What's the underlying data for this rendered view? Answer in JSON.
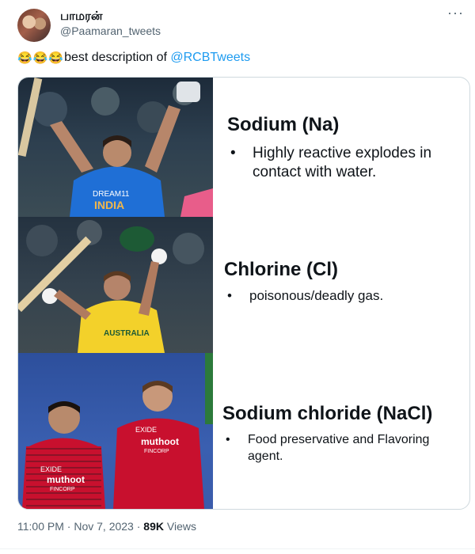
{
  "author": {
    "name": "பாமரன்",
    "handle": "@Paamaran_tweets"
  },
  "menu_icon": "more-horizontal-icon",
  "tweet": {
    "emojis": [
      "😂",
      "😂",
      "😂"
    ],
    "text": "best description of ",
    "mention": "@RCBTweets"
  },
  "card": {
    "sections": [
      {
        "title": "Sodium (Na)",
        "bullet": "Highly reactive explodes in contact with water."
      },
      {
        "title": "Chlorine (Cl)",
        "bullet": "poisonous/deadly gas."
      },
      {
        "title": "Sodium chloride (NaCl)",
        "bullet": "Food preservative and Flavoring agent."
      }
    ],
    "photo_texts": {
      "india": "INDIA",
      "dream11": "DREAM11",
      "australia": "AUSTRALIA",
      "muthoot": "muthoot",
      "fincorp": "FINCORP",
      "exide": "EXIDE"
    }
  },
  "meta": {
    "time": "11:00 PM",
    "sep": " · ",
    "date": "Nov 7, 2023",
    "views_count": "89K",
    "views_label": " Views"
  },
  "colors": {
    "link": "#1d9bf0",
    "muted": "#536471",
    "india_blue": "#1f6fd6",
    "australia_yellow": "#f3d12a",
    "rcb_red": "#c8102e"
  }
}
